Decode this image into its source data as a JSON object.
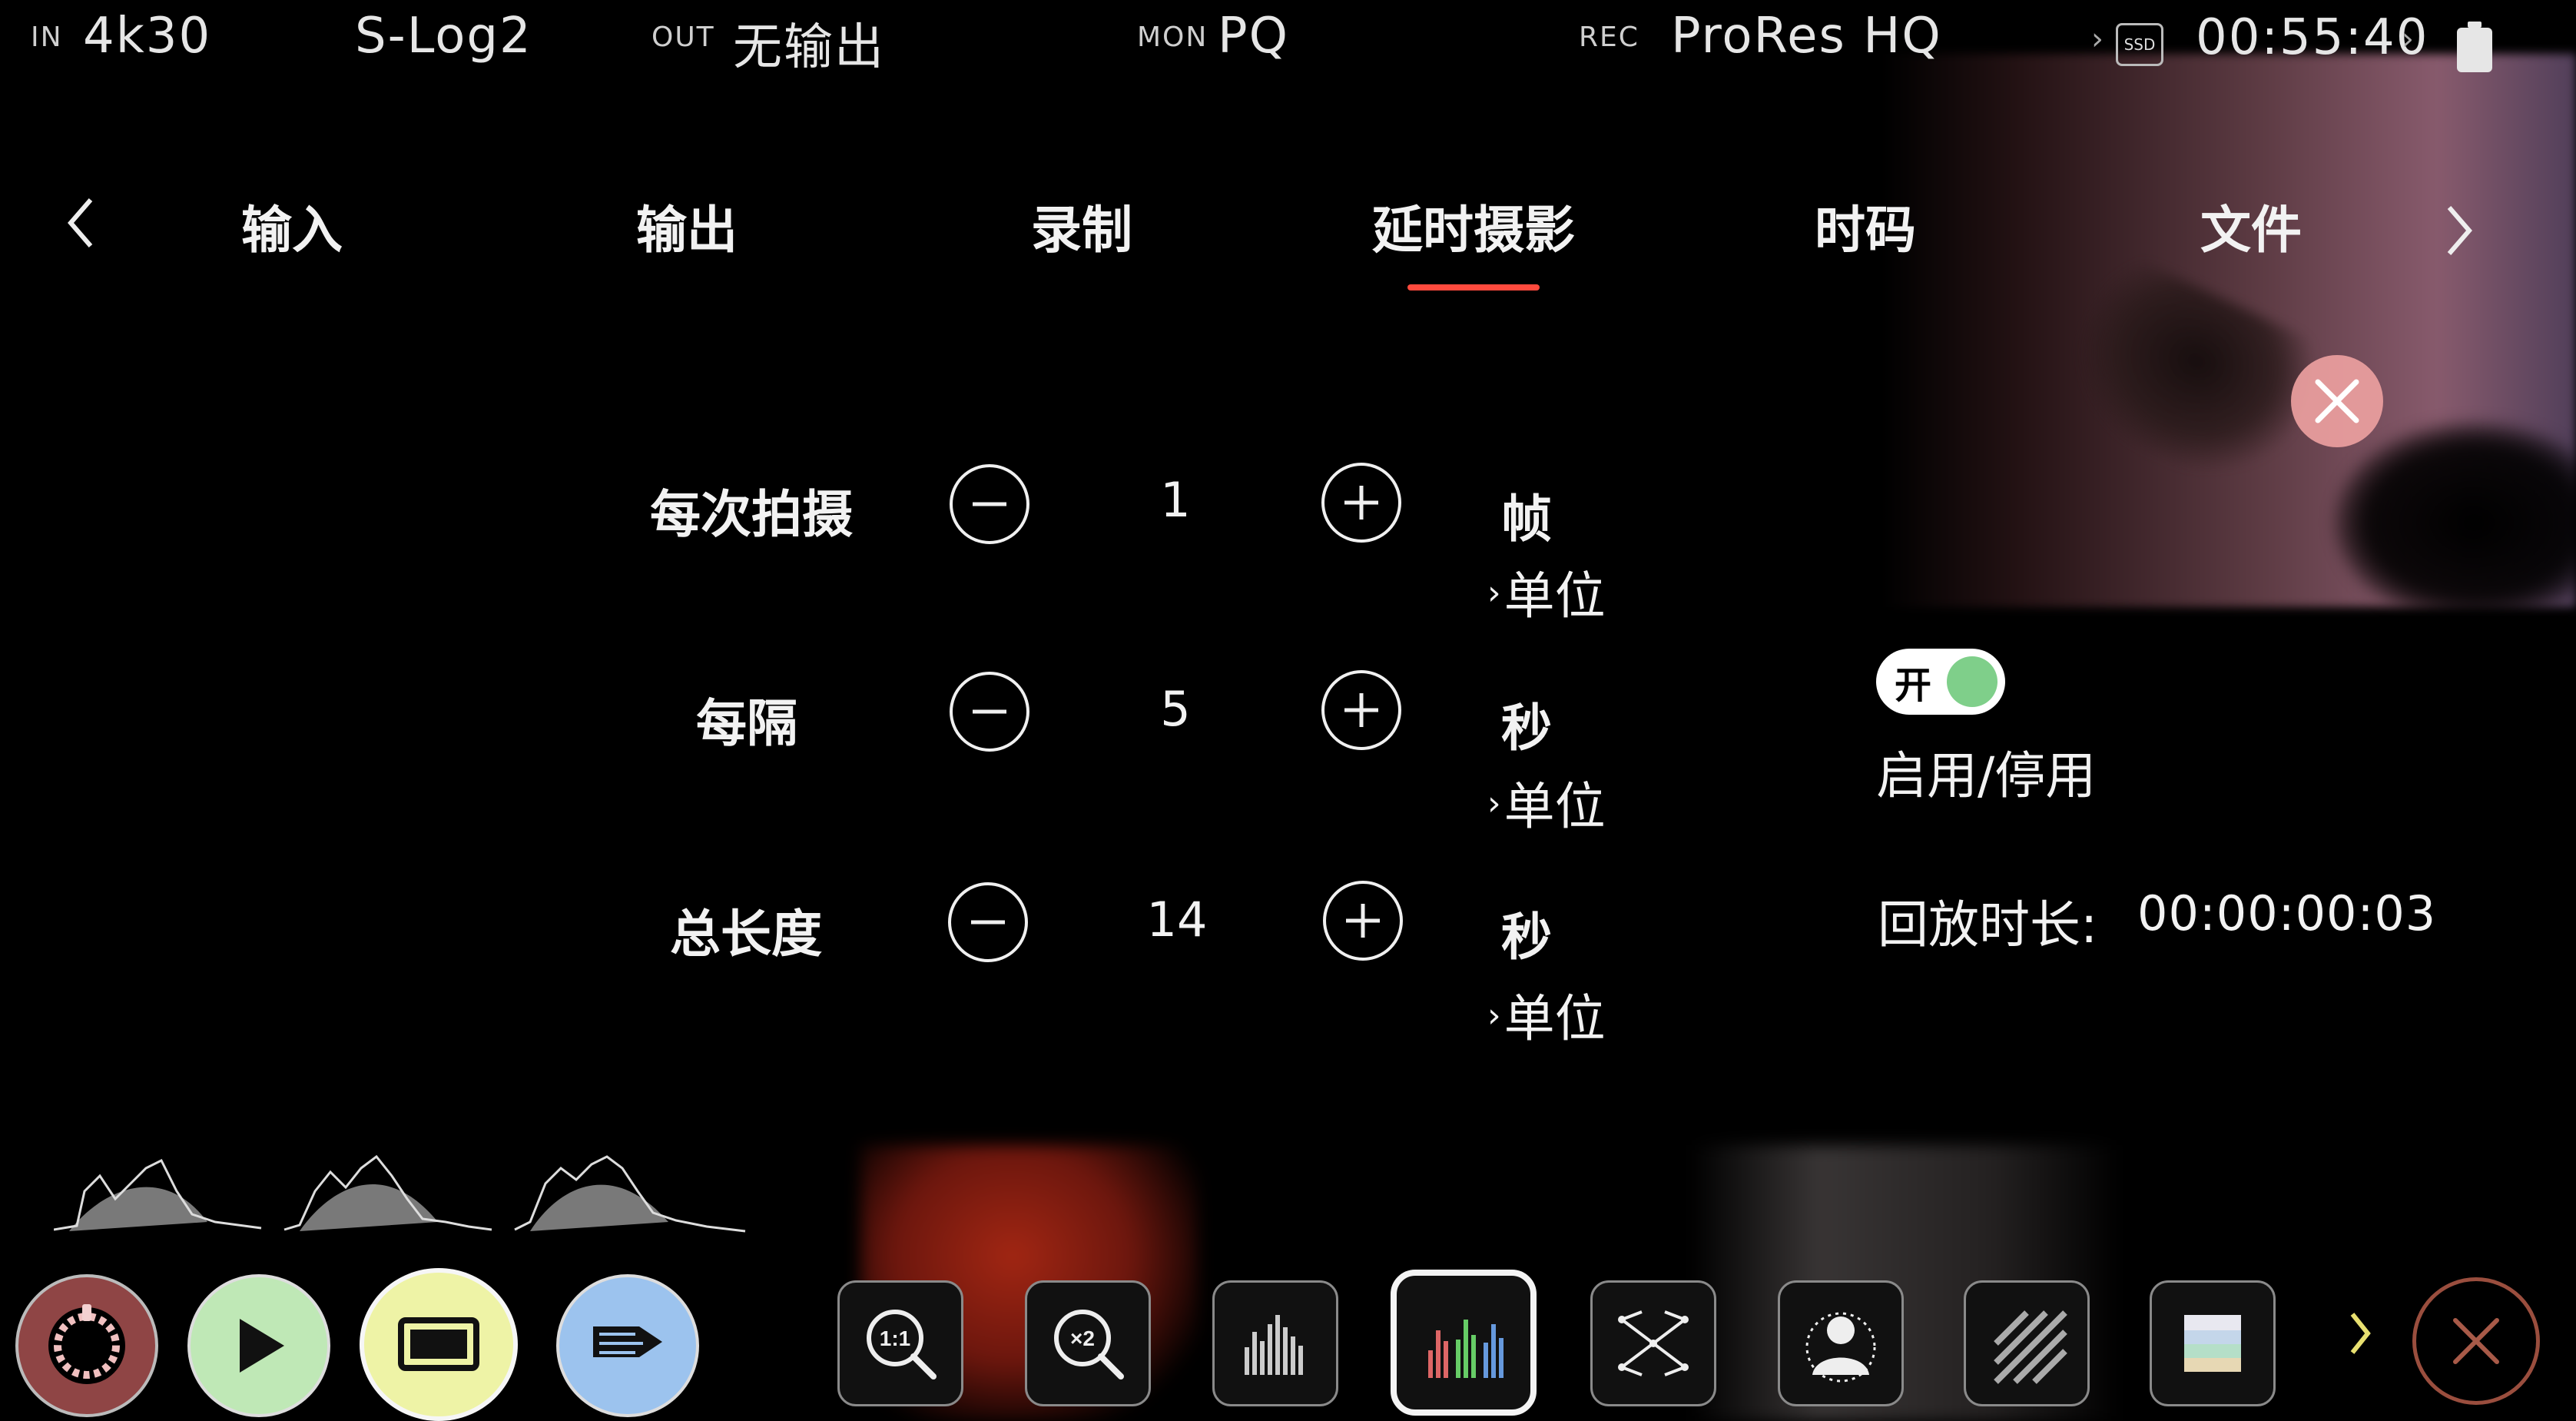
{
  "status_bar": {
    "in_label": "IN",
    "in_value": "4k30",
    "gamma": "S-Log2",
    "out_label": "OUT",
    "out_value": "无输出",
    "mon_label": "MON",
    "mon_value": "PQ",
    "rec_label": "REC",
    "rec_value": "ProRes HQ",
    "media_label": "SSD",
    "timecode": "00:55:40",
    "icons": [
      "ssd-icon",
      "battery-icon"
    ]
  },
  "tabs": [
    {
      "label": "输入",
      "active": false
    },
    {
      "label": "输出",
      "active": false
    },
    {
      "label": "录制",
      "active": false
    },
    {
      "label": "延时摄影",
      "active": true
    },
    {
      "label": "时码",
      "active": false
    },
    {
      "label": "文件",
      "active": false
    }
  ],
  "settings": [
    {
      "label": "每次拍摄",
      "value": "1",
      "unit": "帧",
      "unit_link": "单位"
    },
    {
      "label": "每隔",
      "value": "5",
      "unit": "秒",
      "unit_link": "单位"
    },
    {
      "label": "总长度",
      "value": "14",
      "unit": "秒",
      "unit_link": "单位"
    }
  ],
  "toggle": {
    "state_label": "开",
    "on": true,
    "caption": "启用/停用"
  },
  "playback": {
    "label": "回放时长:",
    "value": "00:00:00:03"
  },
  "toolbar": {
    "zoom_1to1": "1:1",
    "zoom_x2": "×2",
    "tools": [
      "zoom-1to1-icon",
      "zoom-x2-icon",
      "waveform-icon",
      "rgb-parade-icon",
      "focus-peaking-icon",
      "false-color-icon",
      "zebra-icon",
      "color-bars-icon"
    ]
  },
  "colors": {
    "accent_underline": "#ff4a3d",
    "toggle_knob": "#7fcf8a",
    "record_button": "#9a4a4a",
    "play_button": "#bfe8b6",
    "display_button": "#eef3a6",
    "tag_button": "#9cc3ee"
  }
}
